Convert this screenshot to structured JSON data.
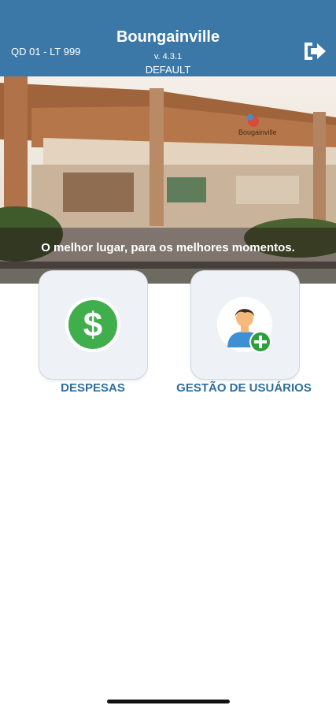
{
  "header": {
    "unit": "QD 01 - LT 999",
    "title": "Boungainville",
    "version": "v. 4.3.1",
    "profile": "DEFAULT",
    "logout_icon": "logout-icon"
  },
  "banner": {
    "tagline": "O melhor lugar, para os melhores momentos.",
    "sign_text": "Bougainville"
  },
  "menu": [
    {
      "label": "DESPESAS",
      "icon": "dollar-icon"
    },
    {
      "label": "GESTÃO DE USUÁRIOS",
      "icon": "add-user-icon"
    }
  ],
  "colors": {
    "header": "#3b78a8",
    "label": "#2f6e9c",
    "dollar_green": "#3fae4b",
    "add_green": "#2e9e3e"
  }
}
